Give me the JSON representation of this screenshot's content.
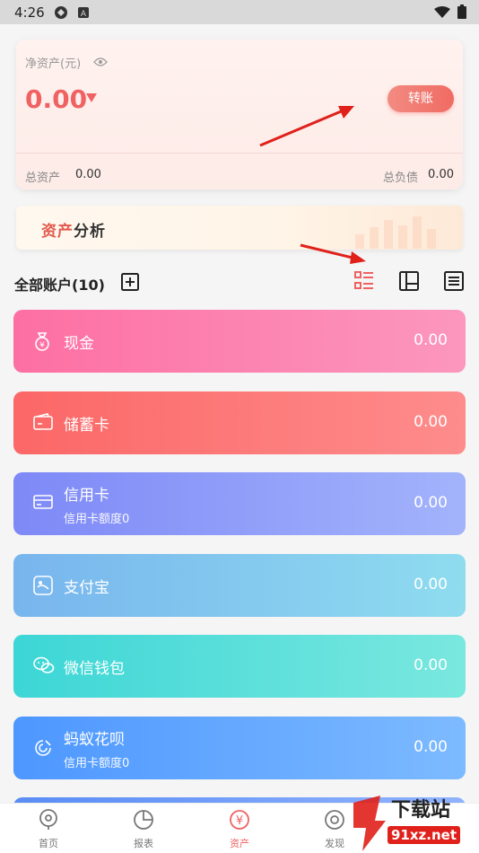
{
  "status_bar": {
    "time": "4:26"
  },
  "asset_summary": {
    "net_label": "净资产(元)",
    "net_value": "0.00",
    "transfer_label": "转账",
    "total_assets_label": "总资产",
    "total_assets_value": "0.00",
    "total_debt_label": "总负债",
    "total_debt_value": "0.00"
  },
  "analysis_banner": {
    "title_part1": "资产",
    "title_part2": "分析"
  },
  "accounts": {
    "title": "全部账户(10)",
    "items": [
      {
        "name": "现金",
        "value": "0.00",
        "sub": "",
        "icon": "money-bag-icon",
        "color_start": "#fd6fa2",
        "color_end": "#fc97bd"
      },
      {
        "name": "储蓄卡",
        "value": "0.00",
        "sub": "",
        "icon": "wallet-card-icon",
        "color_start": "#fc6767",
        "color_end": "#fe8c8c"
      },
      {
        "name": "信用卡",
        "value": "0.00",
        "sub": "信用卡额度0",
        "icon": "credit-card-icon",
        "color_start": "#7e89f7",
        "color_end": "#a3b3fb"
      },
      {
        "name": "支付宝",
        "value": "0.00",
        "sub": "",
        "icon": "alipay-icon",
        "color_start": "#78b5ee",
        "color_end": "#8fdcef"
      },
      {
        "name": "微信钱包",
        "value": "0.00",
        "sub": "",
        "icon": "wechat-icon",
        "color_start": "#3cd6d6",
        "color_end": "#7ae8df"
      },
      {
        "name": "蚂蚁花呗",
        "value": "0.00",
        "sub": "信用卡额度0",
        "icon": "huabei-icon",
        "color_start": "#4d97ff",
        "color_end": "#7dbaff"
      }
    ]
  },
  "bottom_nav": {
    "items": [
      {
        "label": "首页",
        "icon": "home-icon"
      },
      {
        "label": "报表",
        "icon": "pie-chart-icon"
      },
      {
        "label": "资产",
        "icon": "yuan-icon"
      },
      {
        "label": "发现",
        "icon": "discover-icon"
      }
    ]
  },
  "watermark": {
    "text": "下载站",
    "url_text": "91xz.net"
  },
  "colors": {
    "accent": "#f06262",
    "nav_active": "#f06262"
  }
}
